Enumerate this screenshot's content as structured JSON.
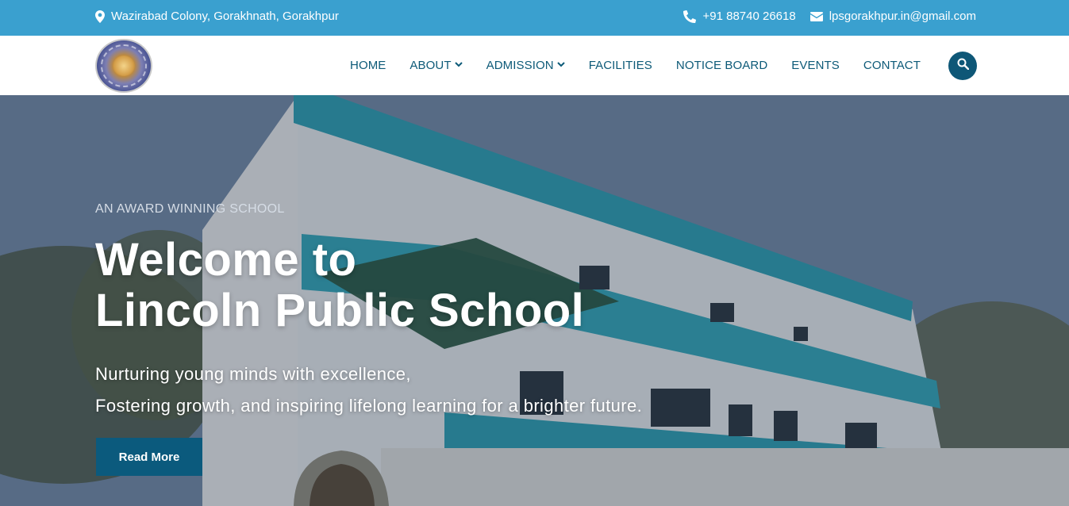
{
  "topbar": {
    "address": "Wazirabad Colony, Gorakhnath, Gorakhpur",
    "phone": "+91 88740 26618",
    "email": "lpsgorakhpur.in@gmail.com"
  },
  "logo": {
    "text": "LINCOLN PUBLIC SCHOOL",
    "subtext": "GORAKHPUR"
  },
  "nav": {
    "items": [
      {
        "label": "HOME"
      },
      {
        "label": "ABOUT"
      },
      {
        "label": "ADMISSION"
      },
      {
        "label": "FACILITIES"
      },
      {
        "label": "NOTICE BOARD"
      },
      {
        "label": "EVENTS"
      },
      {
        "label": "CONTACT"
      }
    ]
  },
  "hero": {
    "eyebrow": "AN AWARD WINNING SCHOOL",
    "headline_line1": "Welcome to",
    "headline_line2": "Lincoln Public School",
    "tagline_line1": "Nurturing young minds with excellence,",
    "tagline_line2": "Fostering growth, and inspiring lifelong learning for a brighter future.",
    "cta_label": "Read More"
  },
  "colors": {
    "topbar_bg": "#3aa0cf",
    "nav_text": "#0d5a78",
    "search_bg": "#0e5777",
    "cta_bg": "#0b5a7d"
  },
  "icons": {
    "address": "map-marker-icon",
    "phone": "phone-icon",
    "email": "envelope-icon",
    "search": "search-icon",
    "dropdown": "chevron-down-icon"
  }
}
